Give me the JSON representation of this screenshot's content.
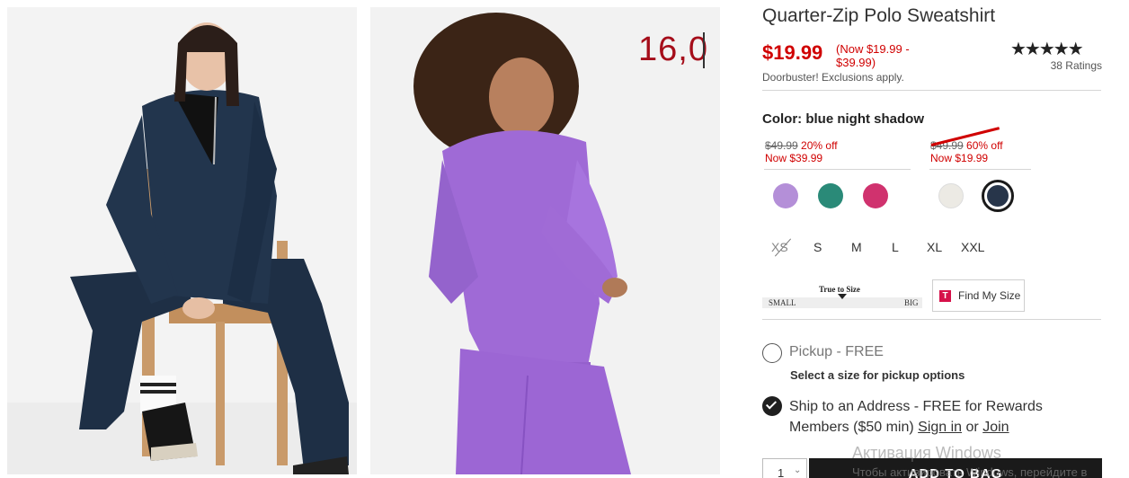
{
  "overlay": {
    "number": "16,0"
  },
  "product": {
    "title": "Quarter-Zip Polo Sweatshirt",
    "price": "$19.99",
    "price_range": "(Now $19.99 - $39.99)",
    "note": "Doorbuster! Exclusions apply.",
    "rating_stars": "★★★★★",
    "rating_value": 4.5,
    "ratings_count": "38 Ratings"
  },
  "color": {
    "label": "Color: blue night shadow",
    "groups": [
      {
        "original": "$49.99",
        "discount": "20% off",
        "now": "Now $39.99"
      },
      {
        "original": "$49.99",
        "discount": "60% off",
        "now": "Now $19.99"
      }
    ],
    "swatches": [
      {
        "name": "purple",
        "hex": "#b48fd8"
      },
      {
        "name": "teal",
        "hex": "#2a8a78"
      },
      {
        "name": "magenta",
        "hex": "#d0326e"
      },
      {
        "name": "cream",
        "hex": "#eceae4"
      },
      {
        "name": "blue night shadow",
        "hex": "#27354a",
        "selected": true
      }
    ]
  },
  "sizes": [
    "XS",
    "S",
    "M",
    "L",
    "XL",
    "XXL"
  ],
  "true_to_size": {
    "label": "True to Size",
    "small": "SMALL",
    "big": "BIG"
  },
  "find_my_size": {
    "icon": "T",
    "label": "Find My Size"
  },
  "fulfillment": {
    "pickup": {
      "label": "Pickup - FREE",
      "note": "Select a size for pickup options",
      "selected": false
    },
    "ship": {
      "text_before": "Ship to an Address - FREE for Rewards Members ($50 min) ",
      "signin": "Sign in",
      "or": " or ",
      "join": "Join",
      "selected": true
    }
  },
  "cart": {
    "quantity": "1",
    "add_label": "ADD TO BAG"
  },
  "watermark": {
    "line1": "Активация Windows",
    "line2": "Чтобы активировать Windows, перейдите в"
  }
}
